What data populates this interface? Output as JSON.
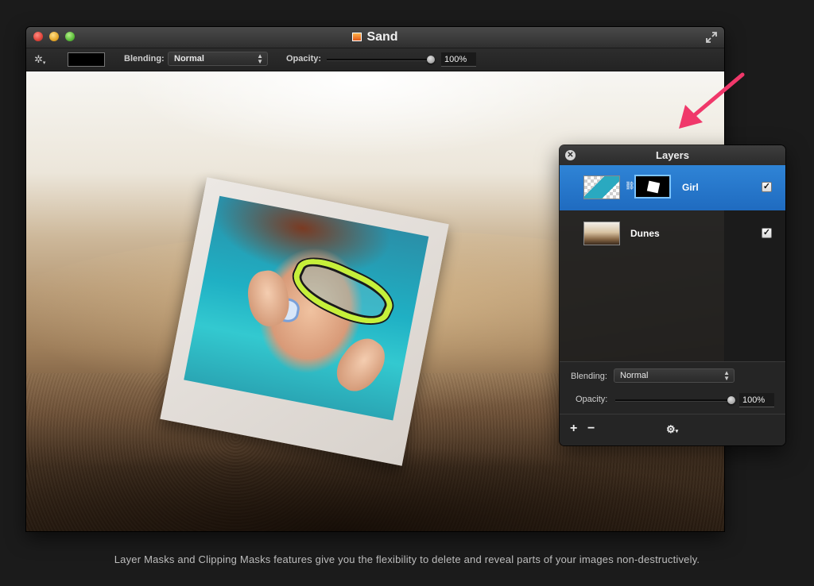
{
  "window": {
    "title": "Sand",
    "controls": [
      "close",
      "minimize",
      "zoom"
    ]
  },
  "toolbar": {
    "gear_icon": "gear-icon",
    "blending_label": "Blending:",
    "blending_value": "Normal",
    "opacity_label": "Opacity:",
    "opacity_value": "100%",
    "opacity_fraction": 1.0,
    "color_well": "#000000"
  },
  "layers_panel": {
    "title": "Layers",
    "layers": [
      {
        "name": "Girl",
        "visible": true,
        "selected": true,
        "has_mask": true
      },
      {
        "name": "Dunes",
        "visible": true,
        "selected": false,
        "has_mask": false
      }
    ],
    "blending_label": "Blending:",
    "blending_value": "Normal",
    "opacity_label": "Opacity:",
    "opacity_value": "100%",
    "opacity_fraction": 1.0,
    "footer": {
      "add": "+",
      "remove": "−",
      "gear": "⚙"
    }
  },
  "caption": "Layer Masks and Clipping Masks features give you the flexibility to delete and reveal parts of your images non-destructively.",
  "colors": {
    "selection": "#2477cc",
    "arrow": "#f0386a"
  }
}
